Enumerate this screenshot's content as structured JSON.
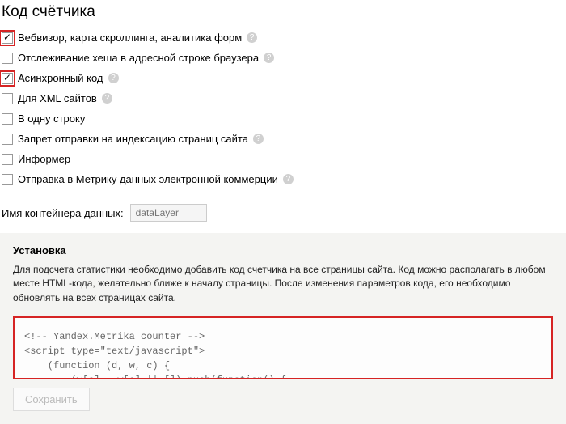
{
  "title": "Код счётчика",
  "options": [
    {
      "label": "Вебвизор, карта скроллинга, аналитика форм",
      "checked": true,
      "help": true,
      "highlight": true
    },
    {
      "label": "Отслеживание хеша в адресной строке браузера",
      "checked": false,
      "help": true,
      "highlight": false
    },
    {
      "label": "Асинхронный код",
      "checked": true,
      "help": true,
      "highlight": true
    },
    {
      "label": "Для XML сайтов",
      "checked": false,
      "help": true,
      "highlight": false
    },
    {
      "label": "В одну строку",
      "checked": false,
      "help": false,
      "highlight": false
    },
    {
      "label": "Запрет отправки на индексацию страниц сайта",
      "checked": false,
      "help": true,
      "highlight": false
    },
    {
      "label": "Информер",
      "checked": false,
      "help": false,
      "highlight": false
    },
    {
      "label": "Отправка в Метрику данных электронной коммерции",
      "checked": false,
      "help": true,
      "highlight": false
    }
  ],
  "container_name": {
    "label": "Имя контейнера данных:",
    "placeholder": "dataLayer"
  },
  "install": {
    "title": "Установка",
    "description": "Для подсчета статистики необходимо добавить код счетчика на все страницы сайта. Код можно располагать в любом месте HTML-кода, желательно ближе к началу страницы. После изменения параметров кода, его необходимо обновлять на всех страницах сайта.",
    "code": "<!-- Yandex.Metrika counter -->\n<script type=\"text/javascript\">\n    (function (d, w, c) {\n        (w[c] = w[c] || []).push(function() {"
  },
  "save_label": "Сохранить",
  "help_glyph": "?"
}
